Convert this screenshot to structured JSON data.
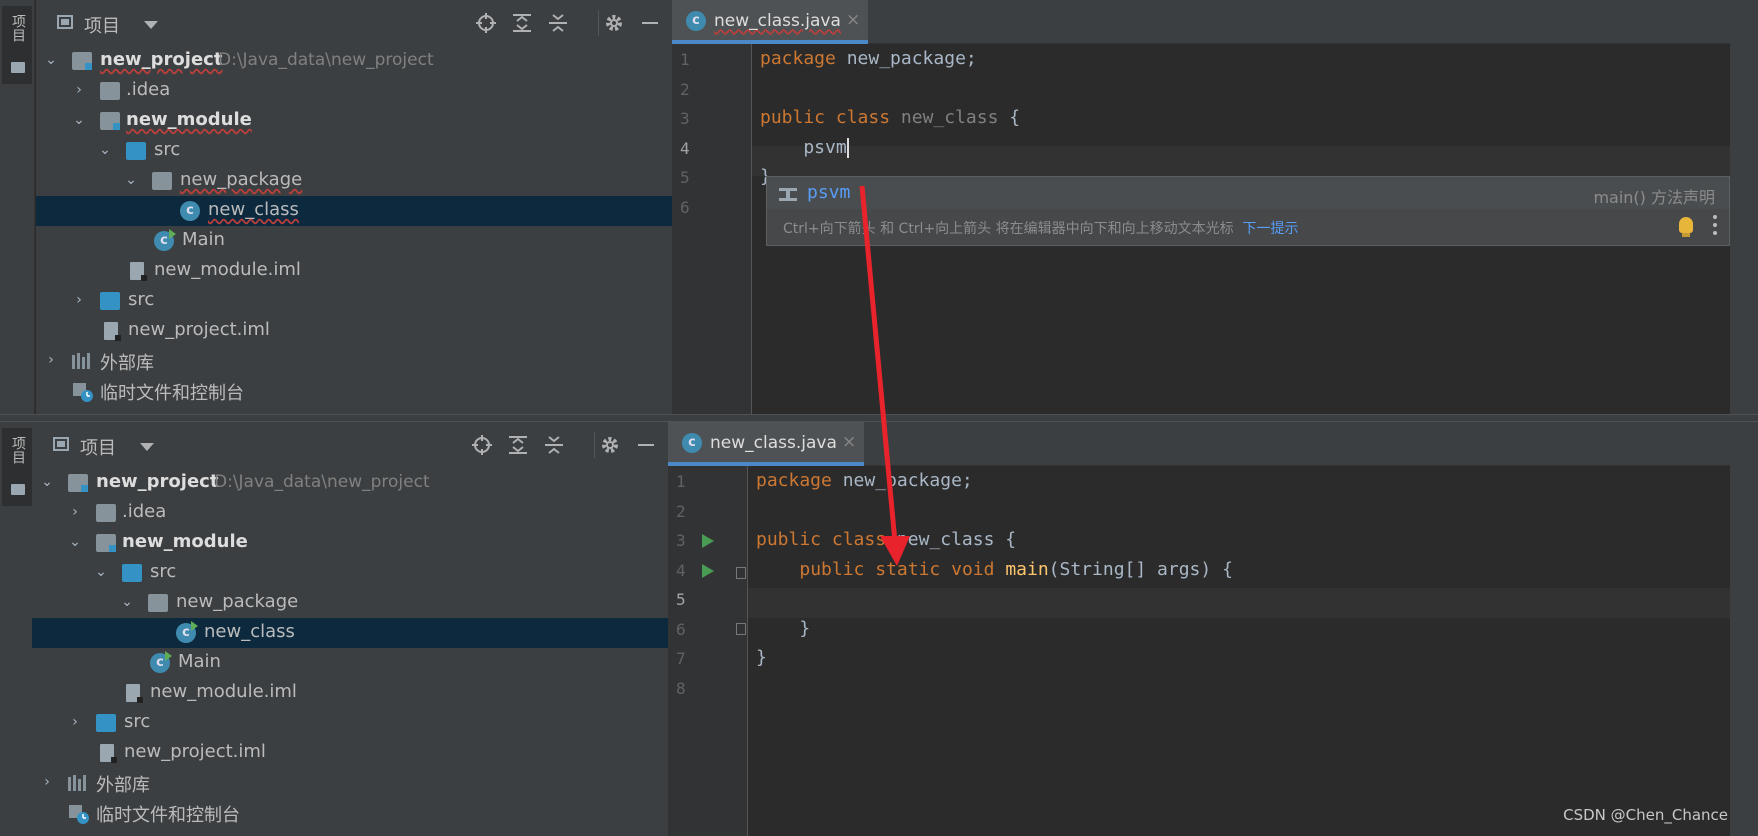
{
  "side_tab": {
    "label": "项目"
  },
  "project_pane": {
    "title": "项目",
    "tree": [
      {
        "label": "new_project",
        "path": "D:\\Java_data\\new_project"
      },
      {
        "label": ".idea"
      },
      {
        "label": "new_module"
      },
      {
        "label": "src"
      },
      {
        "label": "new_package"
      },
      {
        "label": "new_class"
      },
      {
        "label": "Main"
      },
      {
        "label": "new_module.iml"
      },
      {
        "label": "src"
      },
      {
        "label": "new_project.iml"
      },
      {
        "label": "外部库"
      },
      {
        "label": "临时文件和控制台"
      }
    ]
  },
  "editor": {
    "tab_label": "new_class.java",
    "tab_close": "×",
    "top": {
      "line_numbers": [
        "1",
        "2",
        "3",
        "4",
        "5",
        "6"
      ],
      "lines": {
        "l1_kw": "package",
        "l1_rest": " new_package;",
        "l3_kw1": "public",
        "l3_kw2": "class",
        "l3_name": "new_class",
        "l3_rest": " {",
        "l4_text": "    psvm",
        "l5_text": "}"
      },
      "completion": {
        "item": "psvm",
        "description": "main()  方法声明",
        "hint": "Ctrl+向下箭头 和 Ctrl+向上箭头 将在编辑器中向下和向上移动文本光标",
        "hint_link": "下一提示"
      }
    },
    "bottom": {
      "line_numbers": [
        "1",
        "2",
        "3",
        "4",
        "5",
        "6",
        "7",
        "8"
      ],
      "lines": {
        "l1_kw": "package",
        "l1_rest": " new_package;",
        "l3_kw1": "public",
        "l3_kw2": "class",
        "l3_rest": " new_class {",
        "l4_kw1": "public",
        "l4_kw2": "static",
        "l4_kw3": "void",
        "l4_fn": "main",
        "l4_rest": "(String[] args) {",
        "l6_text": "    }",
        "l7_text": "}"
      }
    }
  },
  "annotation": {
    "arrow_color": "#e8232b"
  },
  "watermark": "CSDN @Chen_Chance"
}
